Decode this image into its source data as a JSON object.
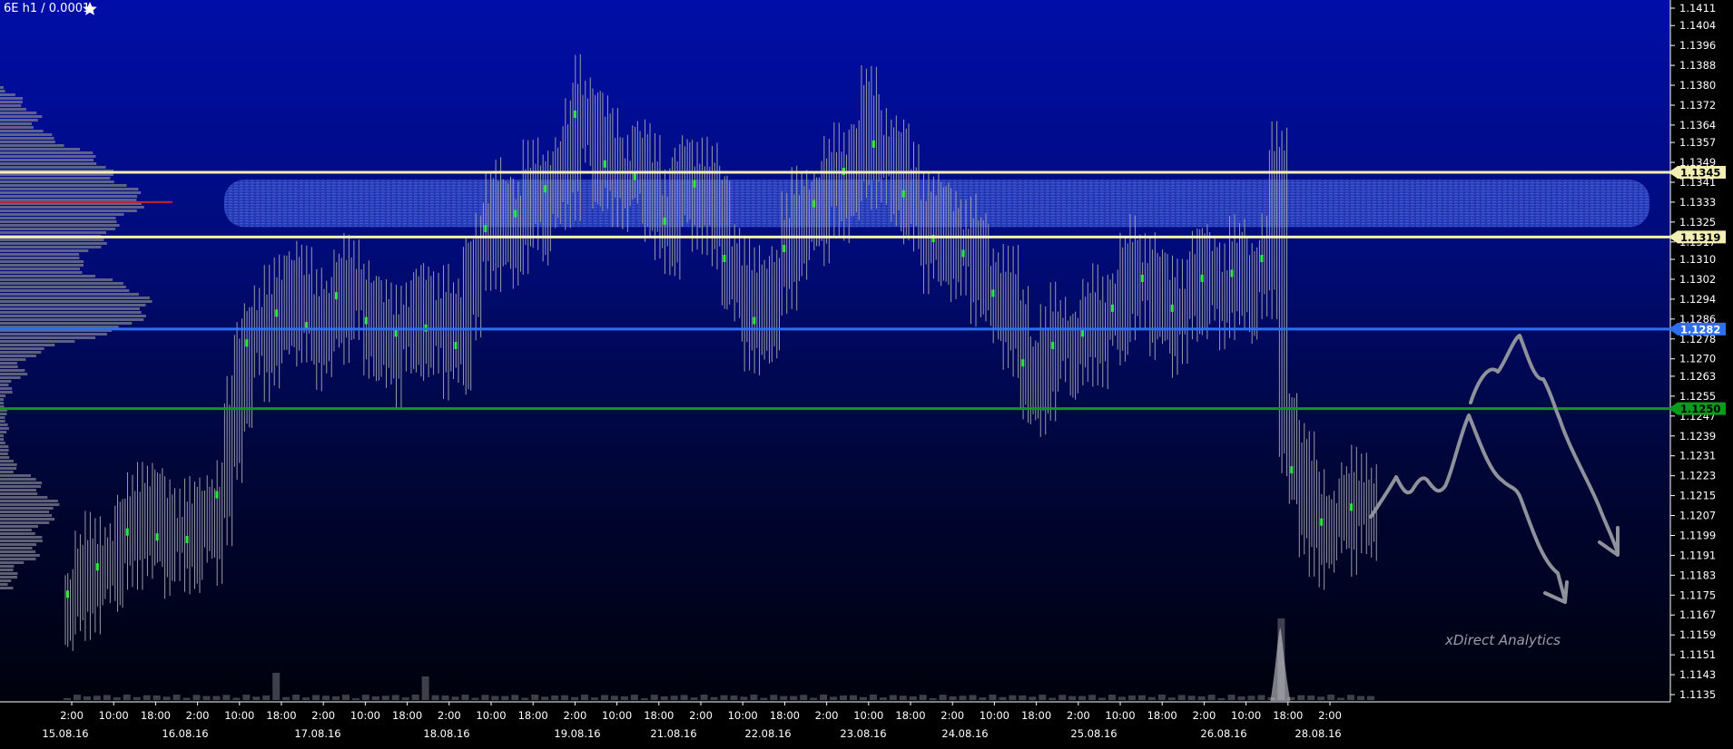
{
  "chart_data": {
    "type": "candlestick",
    "title": "6E h1 / 0.0001",
    "title_icon": "star-icon",
    "watermark": "xDirect Analytics",
    "y_ticks": [
      "1.1411",
      "1.1404",
      "1.1396",
      "1.1388",
      "1.1380",
      "1.1372",
      "1.1364",
      "1.1357",
      "1.1349",
      "1.1341",
      "1.1333",
      "1.1325",
      "1.1317",
      "1.1310",
      "1.1302",
      "1.1294",
      "1.1286",
      "1.1278",
      "1.1270",
      "1.1263",
      "1.1255",
      "1.1247",
      "1.1239",
      "1.1231",
      "1.1223",
      "1.1215",
      "1.1207",
      "1.1199",
      "1.1191",
      "1.1183",
      "1.1175",
      "1.1167",
      "1.1159",
      "1.1151",
      "1.1143",
      "1.1135"
    ],
    "x_time_ticks": [
      "2:00",
      "10:00",
      "18:00",
      "2:00",
      "10:00",
      "18:00",
      "2:00",
      "10:00",
      "18:00",
      "2:00",
      "10:00",
      "18:00",
      "2:00",
      "10:00",
      "18:00",
      "2:00",
      "10:00",
      "18:00",
      "2:00",
      "10:00",
      "18:00",
      "2:00",
      "10:00",
      "18:00",
      "2:00",
      "10:00",
      "18:00",
      "2:00",
      "10:00",
      "18:00",
      "2:00"
    ],
    "x_date_ticks": [
      "15.08.16",
      "16.08.16",
      "17.08.16",
      "18.08.16",
      "19.08.16",
      "21.08.16",
      "22.08.16",
      "23.08.16",
      "24.08.16",
      "25.08.16",
      "26.08.16",
      "28.08.16"
    ],
    "ylim": [
      1.1131,
      1.1415
    ],
    "levels": [
      {
        "price": 1.1345,
        "label": "1.1345",
        "color": "#f3eeb4",
        "label_bg": "#f3eeb4",
        "label_color": "#000000"
      },
      {
        "price": 1.1319,
        "label": "1.1319",
        "color": "#f3eeb4",
        "label_bg": "#f3eeb4",
        "label_color": "#000000"
      },
      {
        "price": 1.1282,
        "label": "1.1282",
        "color": "#2e6ff0",
        "label_bg": "#2e6ff0",
        "label_color": "#ffffff"
      },
      {
        "price": 1.125,
        "label": "1.1250",
        "color": "#0a9a1c",
        "label_bg": "#0a9a1c",
        "label_color": "#000000"
      }
    ],
    "zone": {
      "top": 1.1342,
      "bottom": 1.1323,
      "color": "#3d55d8"
    },
    "close_series": [
      1.1175,
      1.118,
      1.1183,
      1.1186,
      1.119,
      1.1195,
      1.12,
      1.121,
      1.1205,
      1.1198,
      1.12,
      1.1202,
      1.1197,
      1.12,
      1.1204,
      1.1215,
      1.124,
      1.1262,
      1.1276,
      1.1283,
      1.1278,
      1.1288,
      1.13,
      1.129,
      1.1283,
      1.1282,
      1.129,
      1.1295,
      1.1293,
      1.1296,
      1.1285,
      1.1278,
      1.1276,
      1.128,
      1.1284,
      1.1286,
      1.1282,
      1.1288,
      1.1279,
      1.1275,
      1.13,
      1.1315,
      1.1322,
      1.1326,
      1.132,
      1.1328,
      1.1334,
      1.133,
      1.1338,
      1.1344,
      1.135,
      1.1368,
      1.1362,
      1.1352,
      1.1348,
      1.1345,
      1.1347,
      1.1343,
      1.134,
      1.133,
      1.1325,
      1.1334,
      1.1338,
      1.134,
      1.1333,
      1.1325,
      1.131,
      1.1298,
      1.129,
      1.1285,
      1.1292,
      1.1303,
      1.1314,
      1.1322,
      1.1328,
      1.1332,
      1.1336,
      1.134,
      1.1345,
      1.135,
      1.1364,
      1.1356,
      1.1349,
      1.1344,
      1.1336,
      1.133,
      1.1322,
      1.1318,
      1.132,
      1.1316,
      1.1312,
      1.1308,
      1.13,
      1.1296,
      1.129,
      1.1278,
      1.1268,
      1.126,
      1.127,
      1.1275,
      1.1274,
      1.1278,
      1.128,
      1.1283,
      1.1285,
      1.129,
      1.1298,
      1.1304,
      1.1302,
      1.1293,
      1.1286,
      1.129,
      1.1296,
      1.13,
      1.1302,
      1.1298,
      1.13,
      1.1304,
      1.1298,
      1.1302,
      1.131,
      1.134,
      1.1245,
      1.1225,
      1.1215,
      1.12,
      1.1204,
      1.1206,
      1.1208,
      1.121,
      1.1212,
      1.121
    ],
    "profile_poc": 1.1333,
    "volume_spikes": [
      {
        "index": 122,
        "size": 1.0
      },
      {
        "index": 36,
        "size": 0.2
      },
      {
        "index": 21,
        "size": 0.25
      }
    ]
  }
}
